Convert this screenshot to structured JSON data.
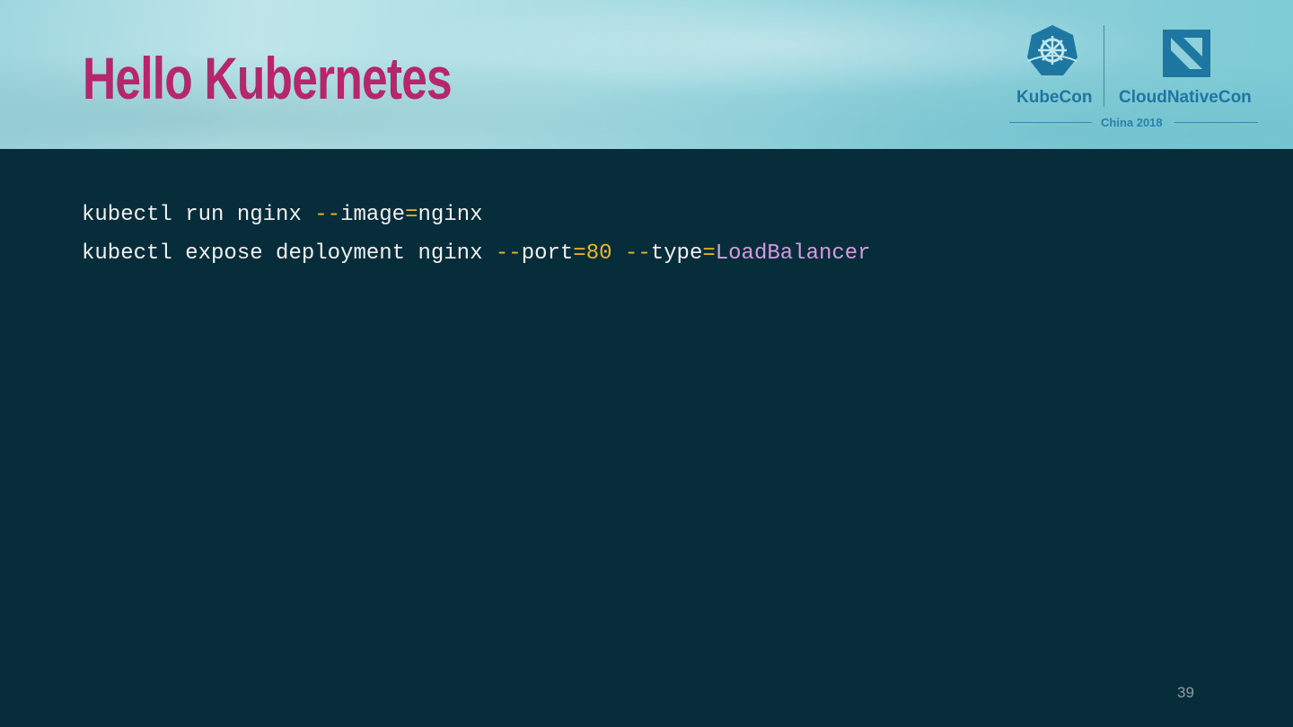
{
  "slide": {
    "title": "Hello Kubernetes",
    "page_number": "39",
    "logo": {
      "kubecon": "KubeCon",
      "cloudnativecon": "CloudNativeCon",
      "event": "China 2018"
    }
  },
  "code": {
    "line1": {
      "cmd": "kubectl run nginx ",
      "flag1": "--",
      "key1": "image",
      "eq1": "=",
      "val1": "nginx"
    },
    "line2": {
      "cmd": "kubectl expose deployment nginx ",
      "flag1": "--",
      "key1": "port",
      "eq1": "=",
      "val1": "80",
      "sp": " ",
      "flag2": "--",
      "key2": "type",
      "eq2": "=",
      "val2": "LoadBalancer"
    }
  },
  "colors": {
    "title": "#b5276a",
    "background": "#082d3a",
    "flag": "#e8b828",
    "string": "#d59be0"
  }
}
